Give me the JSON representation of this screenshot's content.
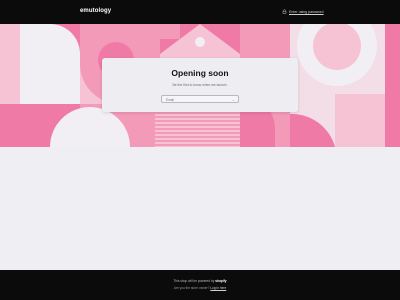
{
  "header": {
    "logo_text": "emutology",
    "owner_link": "Enter using password",
    "owner_icon": "lock-icon"
  },
  "hero": {
    "colors": {
      "primary": "#f07aa6",
      "light": "#f6c3d5",
      "pale": "#f3dde6",
      "white_shape": "#f2eff4"
    }
  },
  "card": {
    "title": "Opening soon",
    "subtitle": "Be the first to know when we launch.",
    "email_placeholder": "Email",
    "submit_icon": "arrow-right-icon"
  },
  "footer": {
    "powered_prefix": "This shop will be powered by",
    "powered_brand": "shopify",
    "login_prefix": "Are you the store owner?",
    "login_link": "Log in here"
  }
}
